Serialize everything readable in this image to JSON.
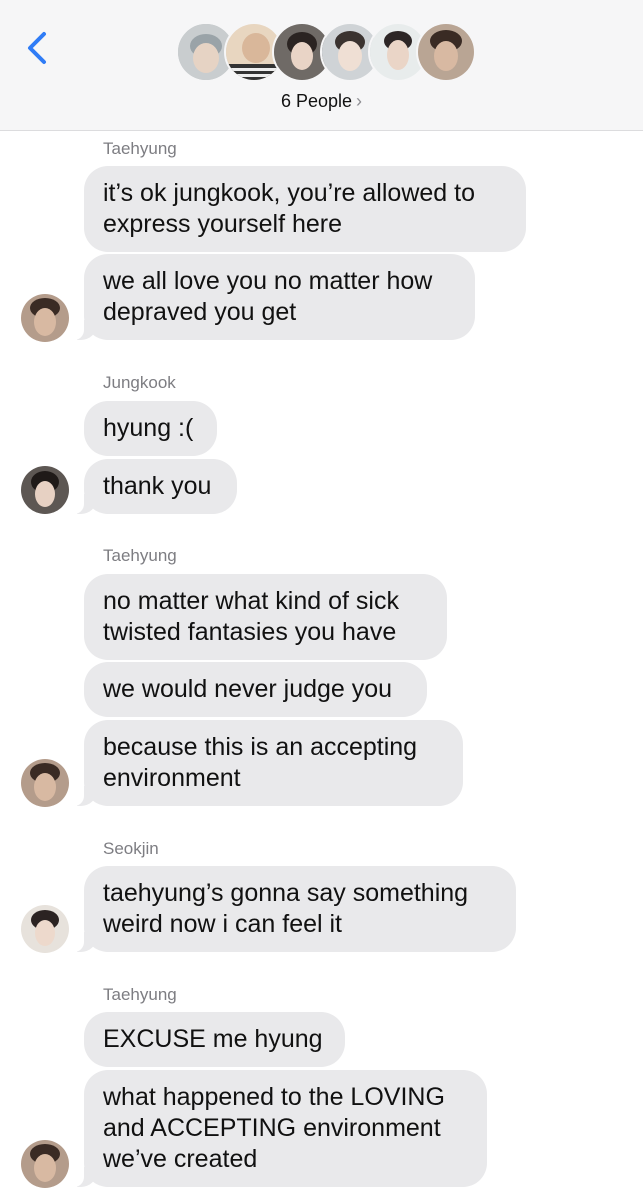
{
  "header": {
    "people_label": "6 People",
    "participants": [
      "avatar-1",
      "avatar-2",
      "avatar-3",
      "avatar-4",
      "avatar-5",
      "avatar-6"
    ]
  },
  "messages": [
    {
      "sender": "Taehyung",
      "bubbles": [
        "it’s ok jungkook, you’re allowed to",
        "express yourself here",
        "we all love you no matter how",
        "depraved you get"
      ]
    },
    {
      "sender": "Jungkook",
      "bubbles": [
        "hyung :(",
        "thank you"
      ]
    },
    {
      "sender": "Taehyung",
      "bubbles": [
        "no matter what kind of sick",
        "twisted fantasies you have",
        "we would never judge you",
        "because this is an accepting",
        "environment"
      ]
    },
    {
      "sender": "Seokjin",
      "bubbles": [
        "taehyung’s gonna say something",
        "weird now i can feel it"
      ]
    },
    {
      "sender": "Taehyung",
      "bubbles": [
        "EXCUSE me hyung",
        "what happened to the LOVING",
        "and ACCEPTING environment",
        "we’ve created"
      ]
    }
  ],
  "colors": {
    "accent": "#2f7cf6",
    "bubble": "#e9e9eb",
    "header_bg": "#f6f6f7",
    "sender_text": "#7d7d82"
  }
}
